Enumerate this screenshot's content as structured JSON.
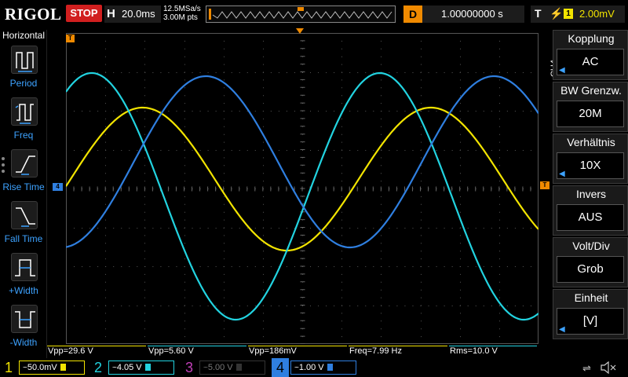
{
  "header": {
    "logo": "RIGOL",
    "run_state": "STOP",
    "timebase_label": "H",
    "timebase": "20.0ms",
    "sample_rate": "12.5MSa/s",
    "memory_depth": "3.00M pts",
    "delay_label": "D",
    "delay": "1.00000000 s",
    "trigger_label": "T",
    "trigger_channel": "1",
    "trigger_level": "2.00mV"
  },
  "left_menu": {
    "title": "Horizontal",
    "items": [
      {
        "label": "Period",
        "icon": "period-icon"
      },
      {
        "label": "Freq",
        "icon": "frequency-icon"
      },
      {
        "label": "Rise Time",
        "icon": "rise-time-icon"
      },
      {
        "label": "Fall Time",
        "icon": "fall-time-icon"
      },
      {
        "label": "+Width",
        "icon": "positive-width-icon"
      },
      {
        "label": "-Width",
        "icon": "negative-width-icon"
      }
    ]
  },
  "right_menu": {
    "channel_tag": "CH4",
    "items": [
      {
        "title": "Kopplung",
        "value": "AC",
        "has_arrow": true
      },
      {
        "title": "BW Grenzw.",
        "value": "20M",
        "has_arrow": false
      },
      {
        "title": "Verhältnis",
        "value": "10X",
        "has_arrow": true
      },
      {
        "title": "Invers",
        "value": "AUS",
        "has_arrow": false
      },
      {
        "title": "Volt/Div",
        "value": "Grob",
        "has_arrow": false
      },
      {
        "title": "Einheit",
        "value": "[V]",
        "has_arrow": true
      }
    ]
  },
  "markers": {
    "ch1": "T",
    "ch4": "4",
    "trigger_level": "T"
  },
  "measurements": [
    {
      "label": "Vpp=29.6 V"
    },
    {
      "label": "Vpp=5.60 V"
    },
    {
      "label": "Vpp=186mV"
    },
    {
      "label": "Freq=7.99 Hz"
    },
    {
      "label": "Rms=10.0 V"
    }
  ],
  "channels": [
    {
      "num": "1",
      "coupling": "~",
      "scale": "50.0mV",
      "color": "#f2e400",
      "active": true
    },
    {
      "num": "2",
      "coupling": "~",
      "scale": "4.05 V",
      "color": "#22d3e0",
      "active": true
    },
    {
      "num": "3",
      "coupling": "~",
      "scale": "5.00 V",
      "color": "#c13fb8",
      "active": false
    },
    {
      "num": "4",
      "coupling": "~",
      "scale": "1.00 V",
      "color": "#2f7fe0",
      "active": true
    }
  ],
  "colors": {
    "ch1": "#f2e400",
    "ch2": "#22d3e0",
    "ch4": "#2f7fe0",
    "stop": "#d11f1f",
    "accent": "#f08a00"
  }
}
